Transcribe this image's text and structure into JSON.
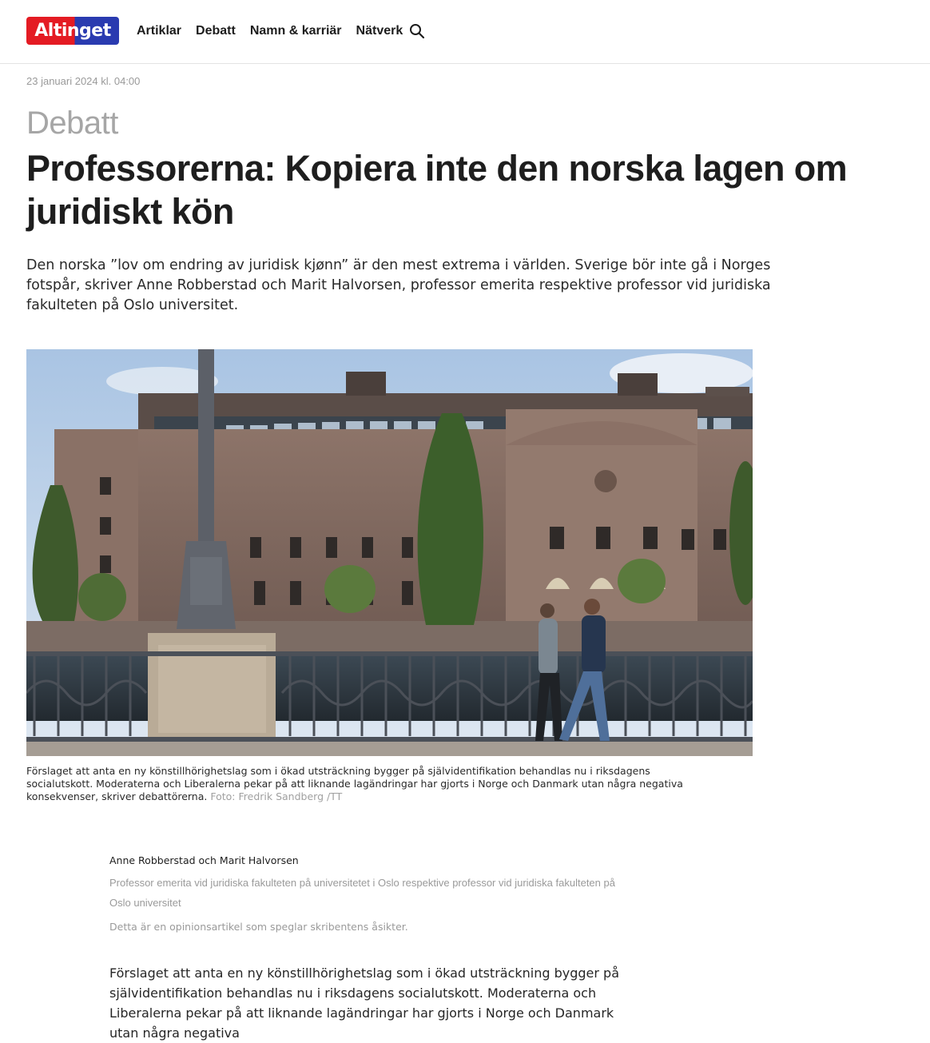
{
  "header": {
    "logo_text": "Altinget",
    "nav": [
      "Artiklar",
      "Debatt",
      "Namn & karriär",
      "Nätverk"
    ],
    "search_icon": "search-icon",
    "colors": {
      "logo_red": "#e41b23",
      "logo_blue": "#2a3bb0"
    }
  },
  "article": {
    "date": "23 januari 2024 kl. 04:00",
    "section": "Debatt",
    "headline": "Professorerna: Kopiera inte den norska lagen om juridiskt kön",
    "lead": "Den norska ”lov om endring av juridisk kjønn” är den mest extrema i världen. Sverige bör inte gå i Norges fotspår, skriver Anne Robberstad och Marit Halvorsen, professor emerita respektive professor vid juridiska fakulteten på Oslo universitet.",
    "caption": "Förslaget att anta en ny könstillhörighetslag som i ökad utsträckning bygger på självidentifikation behandlas nu i riksdagens socialutskott. Moderaterna och Liberalerna pekar på att liknande lagändringar har gjorts i Norge och Danmark utan några negativa konsekvenser, skriver debattörerna.",
    "photo_credit": "Foto: Fredrik Sandberg /TT",
    "author_names": "Anne Robberstad och Marit Halvorsen",
    "author_role": "Professor emerita vid juridiska fakulteten på universitetet i Oslo respektive professor vid juridiska fakulteten på Oslo universitet",
    "opinion_note": "Detta är en opinionsartikel som speglar skribentens åsikter.",
    "body_first": "Förslaget att anta en ny könstillhörighetslag som i ökad utsträckning bygger på självidentifikation behandlas nu i riksdagens socialutskott. Moderaterna och Liberalerna pekar på att liknande lagändringar har gjorts i Norge och Danmark utan några negativa"
  }
}
